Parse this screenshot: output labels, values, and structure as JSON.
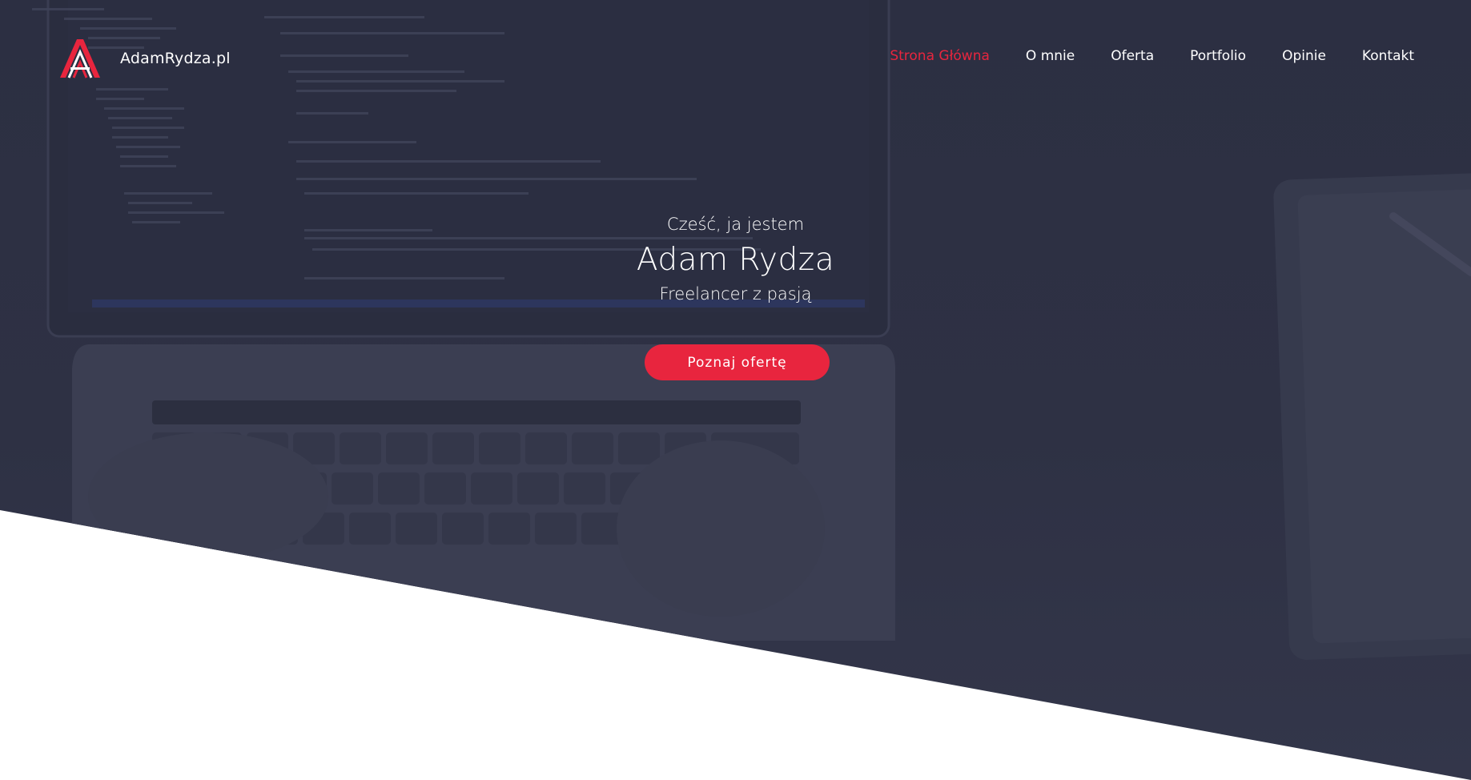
{
  "brand": {
    "name": "AdamRydza.pl",
    "logo_icon": "letter-a-logo",
    "accent_color": "#e8253e"
  },
  "nav": {
    "items": [
      {
        "label": "Strona Główna",
        "active": true
      },
      {
        "label": "O mnie",
        "active": false
      },
      {
        "label": "Oferta",
        "active": false
      },
      {
        "label": "Portfolio",
        "active": false
      },
      {
        "label": "Opinie",
        "active": false
      },
      {
        "label": "Kontakt",
        "active": false
      }
    ]
  },
  "hero": {
    "greeting": "Cześć, ja jestem",
    "name": "Adam Rydza",
    "tagline": "Freelancer z pasją",
    "cta_label": "Poznaj ofertę",
    "background_color": "#2e3144"
  }
}
